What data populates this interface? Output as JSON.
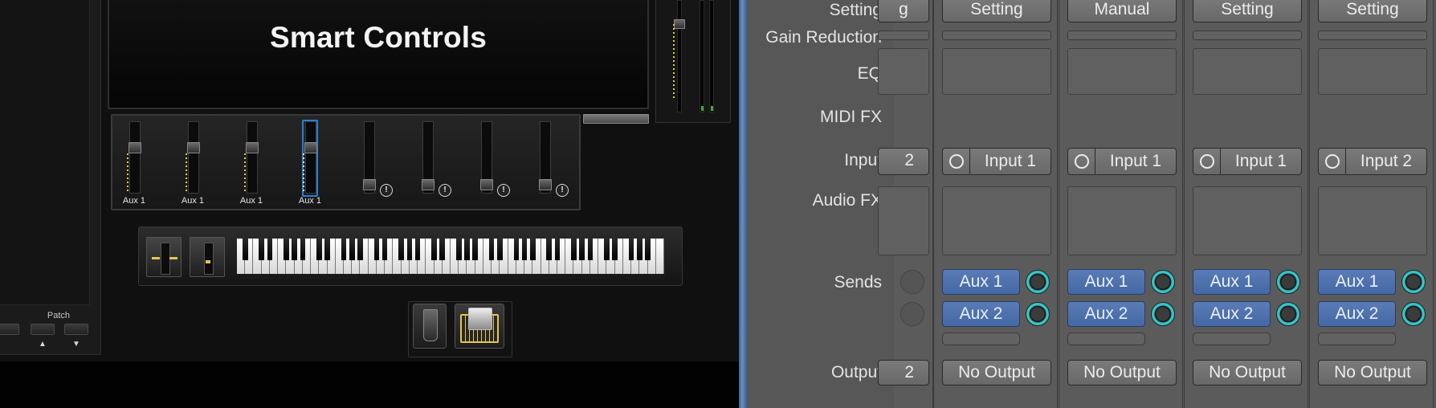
{
  "smart_controls": {
    "title": "Smart Controls",
    "patch_label": "Patch",
    "patch_up": "▲",
    "patch_down": "▼",
    "faders": [
      {
        "label": "Aux 1",
        "level": 0.55,
        "selected": false,
        "warning": false
      },
      {
        "label": "Aux 1",
        "level": 0.55,
        "selected": false,
        "warning": false
      },
      {
        "label": "Aux 1",
        "level": 0.55,
        "selected": false,
        "warning": false
      },
      {
        "label": "Aux 1",
        "level": 0.55,
        "selected": true,
        "warning": false
      },
      {
        "label": "",
        "level": 0.0,
        "selected": false,
        "warning": true
      },
      {
        "label": "",
        "level": 0.0,
        "selected": false,
        "warning": true
      },
      {
        "label": "",
        "level": 0.0,
        "selected": false,
        "warning": true
      },
      {
        "label": "",
        "level": 0.0,
        "selected": false,
        "warning": true
      }
    ],
    "warning_glyph": "!"
  },
  "mixer": {
    "row_labels": {
      "setting": "Setting",
      "gain_reduction": "Gain Reduction",
      "eq": "EQ",
      "midi_fx": "MIDI FX",
      "input": "Input",
      "audio_fx": "Audio FX",
      "sends": "Sends",
      "output": "Output"
    },
    "partial_strip": {
      "setting": "g",
      "input": "2",
      "output": "2"
    },
    "strips": [
      {
        "setting": "Setting",
        "input": "Input 1",
        "send1": "Aux 1",
        "send2": "Aux 2",
        "output": "No Output"
      },
      {
        "setting": "Manual",
        "input": "Input 1",
        "send1": "Aux 1",
        "send2": "Aux 2",
        "output": "No Output"
      },
      {
        "setting": "Setting",
        "input": "Input 1",
        "send1": "Aux 1",
        "send2": "Aux 2",
        "output": "No Output"
      },
      {
        "setting": "Setting",
        "input": "Input 2",
        "send1": "Aux 1",
        "send2": "Aux 2",
        "output": "No Output"
      }
    ]
  },
  "colors": {
    "accent_blue": "#2a7ed6",
    "send_blue": "#4f72ae",
    "knob_cyan": "#35c4c8",
    "led_yellow": "#e5c84a",
    "meter_green": "#38b233"
  }
}
